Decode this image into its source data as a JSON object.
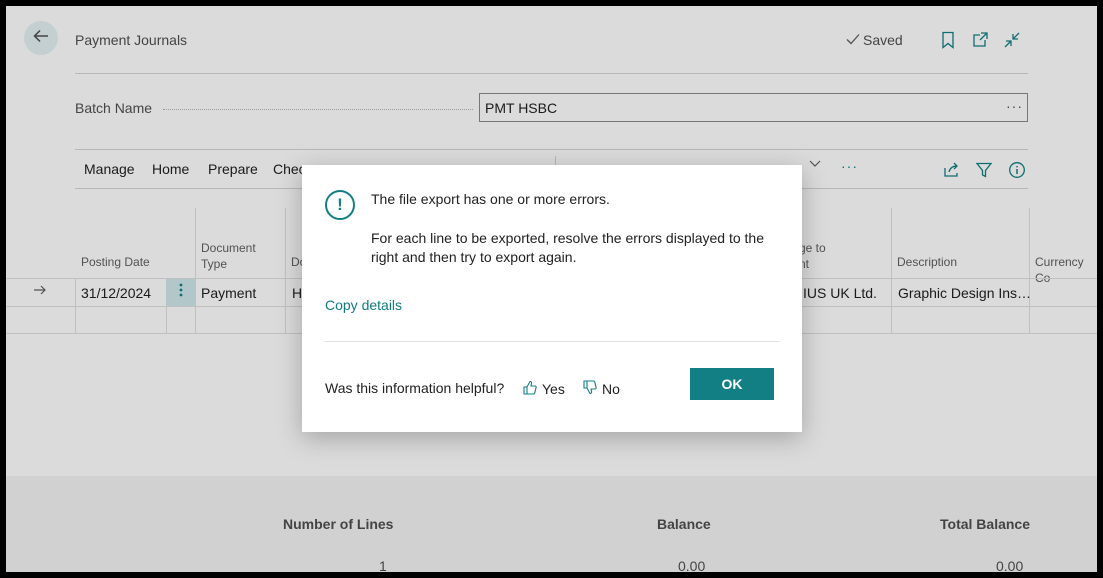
{
  "header": {
    "title": "Payment Journals",
    "saved_label": "Saved",
    "icons": [
      "back-arrow-icon",
      "bookmark-icon",
      "open-new-window-icon",
      "collapse-icon"
    ]
  },
  "batch": {
    "label": "Batch Name",
    "value": "PMT HSBC",
    "more": "···"
  },
  "actionbar": {
    "items": [
      "Manage",
      "Home",
      "Prepare",
      "Chec"
    ],
    "more": "···",
    "icons": [
      "share-icon",
      "filter-icon",
      "info-icon"
    ]
  },
  "grid": {
    "columns": {
      "posting_date": "Posting Date",
      "document_type_1": "Document",
      "document_type_2": "Type",
      "document_no_partial": "Do",
      "charge_to_1": "ge to",
      "charge_to_2": "nt",
      "description": "Description",
      "currency_code": "Currency Co"
    },
    "rows": [
      {
        "posting_date": "31/12/2024",
        "document_type": "Payment",
        "document_no_partial": "H",
        "account_partial": "IUS UK Ltd.",
        "description": "Graphic Design Ins…"
      }
    ]
  },
  "footer": {
    "number_of_lines_label": "Number of Lines",
    "number_of_lines_value": "1",
    "balance_label": "Balance",
    "balance_value": "0.00",
    "total_balance_label": "Total Balance",
    "total_balance_value": "0.00"
  },
  "dialog": {
    "icon_glyph": "!",
    "message": "The file export has one or more errors.",
    "detail": "For each line to be exported, resolve the errors displayed to the right and then try to export again.",
    "copy_details": "Copy details",
    "helpful_question": "Was this information helpful?",
    "yes": "Yes",
    "no": "No",
    "ok": "OK"
  },
  "colors": {
    "accent": "#127f85",
    "link": "#0f7c82",
    "selection": "#cfe8ec"
  }
}
